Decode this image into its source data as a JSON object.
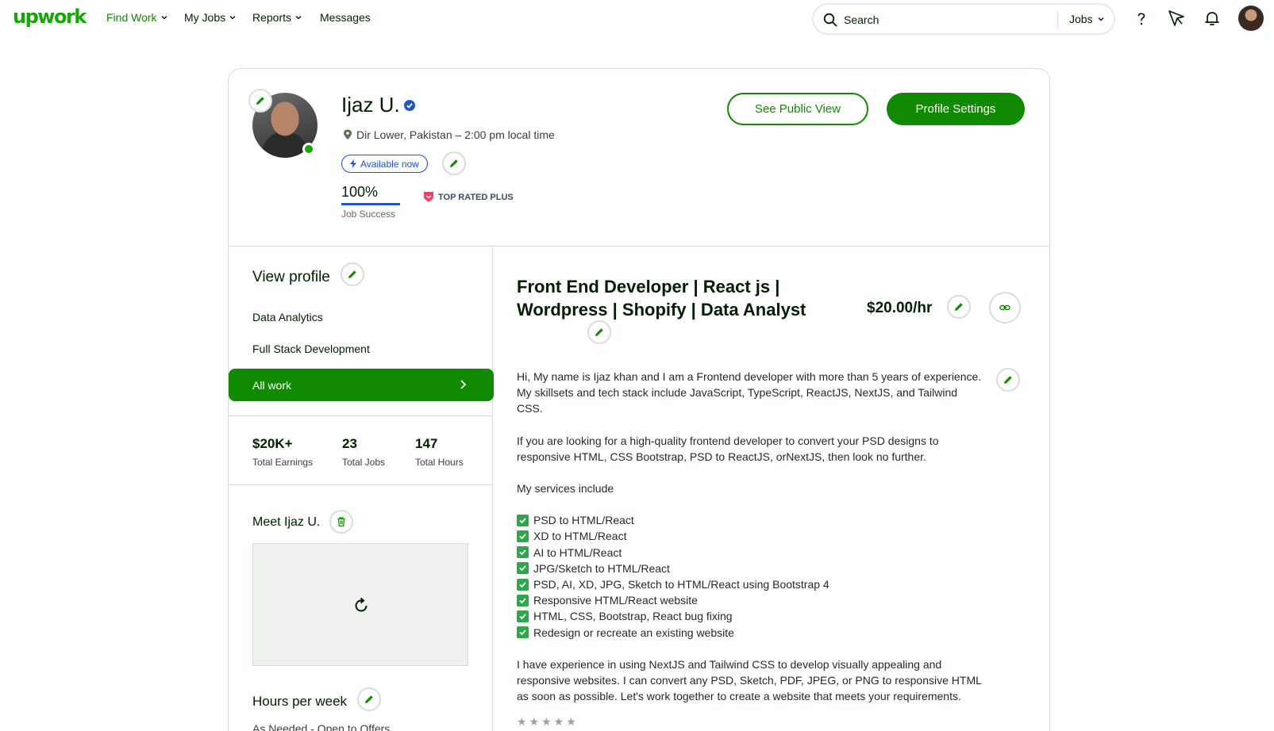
{
  "nav": {
    "logo": "upwork",
    "find_work": "Find Work",
    "my_jobs": "My Jobs",
    "reports": "Reports",
    "messages": "Messages",
    "search_placeholder": "Search",
    "search_scope": "Jobs",
    "help_icon": "help-icon",
    "direct_contracts_icon": "send-icon",
    "notifications_icon": "bell-icon"
  },
  "profile": {
    "name": "Ijaz U.",
    "location": "Dir Lower, Pakistan – 2:00 pm local time",
    "availability": "Available now",
    "job_success_value": "100%",
    "job_success_fraction": 1.0,
    "job_success_label": "Job Success",
    "badge": "TOP RATED PLUS",
    "see_public_view": "See Public View",
    "profile_settings": "Profile Settings"
  },
  "left": {
    "view_profile": "View profile",
    "specialties": [
      "Data Analytics",
      "Full Stack Development"
    ],
    "all_work": "All work",
    "stats": [
      {
        "value": "$20K+",
        "label": "Total Earnings"
      },
      {
        "value": "23",
        "label": "Total Jobs"
      },
      {
        "value": "147",
        "label": "Total Hours"
      }
    ],
    "meet_title": "Meet Ijaz U.",
    "hours_title": "Hours per week",
    "hours_value": "As Needed - Open to Offers"
  },
  "right": {
    "title": "Front End Developer | React js | Wordpress | Shopify | Data Analyst",
    "rate": "$20.00/hr",
    "paragraphs": [
      "Hi, My name is Ijaz khan and I am a Frontend developer with more than 5 years of experience. My skillsets and tech stack include JavaScript, TypeScript, ReactJS, NextJS, and Tailwind CSS.",
      "If you are looking for a high-quality frontend developer to convert your PSD designs to responsive HTML, CSS Bootstrap, PSD to ReactJS, orNextJS, then look no further.",
      "My services include"
    ],
    "services": [
      "PSD to HTML/React",
      "XD to HTML/React",
      "AI to HTML/React",
      "JPG/Sketch to HTML/React",
      "PSD, AI, XD, JPG, Sketch to HTML/React using Bootstrap 4",
      "Responsive HTML/React website",
      "HTML, CSS, Bootstrap, React bug fixing",
      "Redesign or recreate an existing website"
    ],
    "closing": "I have experience in using NextJS and Tailwind CSS to develop visually appealing and responsive websites. I can convert any PSD, Sketch, PDF, JPEG, or PNG to responsive HTML as soon as possible. Let's work together to create a website that meets your requirements.",
    "trailing": "★★★★★"
  },
  "colors": {
    "brand": "#14a800",
    "brand_dark": "#108a00",
    "verified": "#1f57c3",
    "badge": "#e3466b"
  }
}
